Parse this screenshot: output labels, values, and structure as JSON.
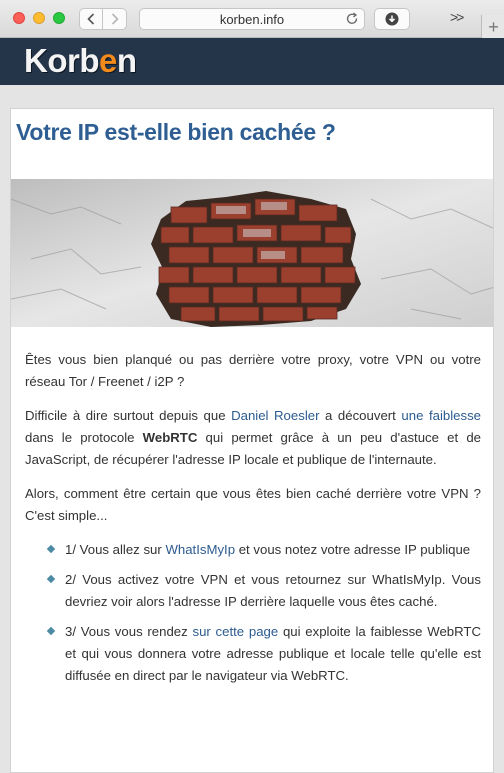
{
  "browser": {
    "url": "korben.info",
    "overflow_label": ">>",
    "new_tab_label": "+"
  },
  "site": {
    "logo_left": "Korb",
    "logo_accent": "e",
    "logo_right": "n",
    "accent_color": "#f28a1c",
    "header_color": "#243449"
  },
  "article": {
    "title": "Votre IP est-elle bien cachée ?",
    "p1": "Êtes vous bien planqué ou pas derrière votre proxy, votre VPN ou votre réseau Tor / Freenet / i2P ?",
    "p2": {
      "before": "Difficile à dire surtout depuis que ",
      "link1": "Daniel Roesler",
      "mid1": " a découvert ",
      "link2": "une faiblesse",
      "mid2": " dans le protocole ",
      "bold": "WebRTC",
      "after": " qui permet grâce à un peu d'astuce et de JavaScript, de récupérer l'adresse IP locale et publique de l'internaute."
    },
    "p3": "Alors, comment être certain que vous êtes bien caché derrière votre VPN ? C'est simple...",
    "steps": [
      {
        "before": "1/ Vous allez sur ",
        "link": "WhatIsMyIp",
        "after": " et vous notez votre adresse IP publique"
      },
      {
        "text": "2/ Vous activez votre VPN et vous retournez sur WhatIsMyIp. Vous devriez voir alors l'adresse IP derrière laquelle vous êtes caché."
      },
      {
        "before": "3/ Vous vous rendez ",
        "link": "sur cette page",
        "after": " qui exploite la faiblesse WebRTC et qui vous donnera votre adresse publique et locale telle qu'elle est diffusée en direct par le navigateur via WebRTC."
      }
    ]
  }
}
